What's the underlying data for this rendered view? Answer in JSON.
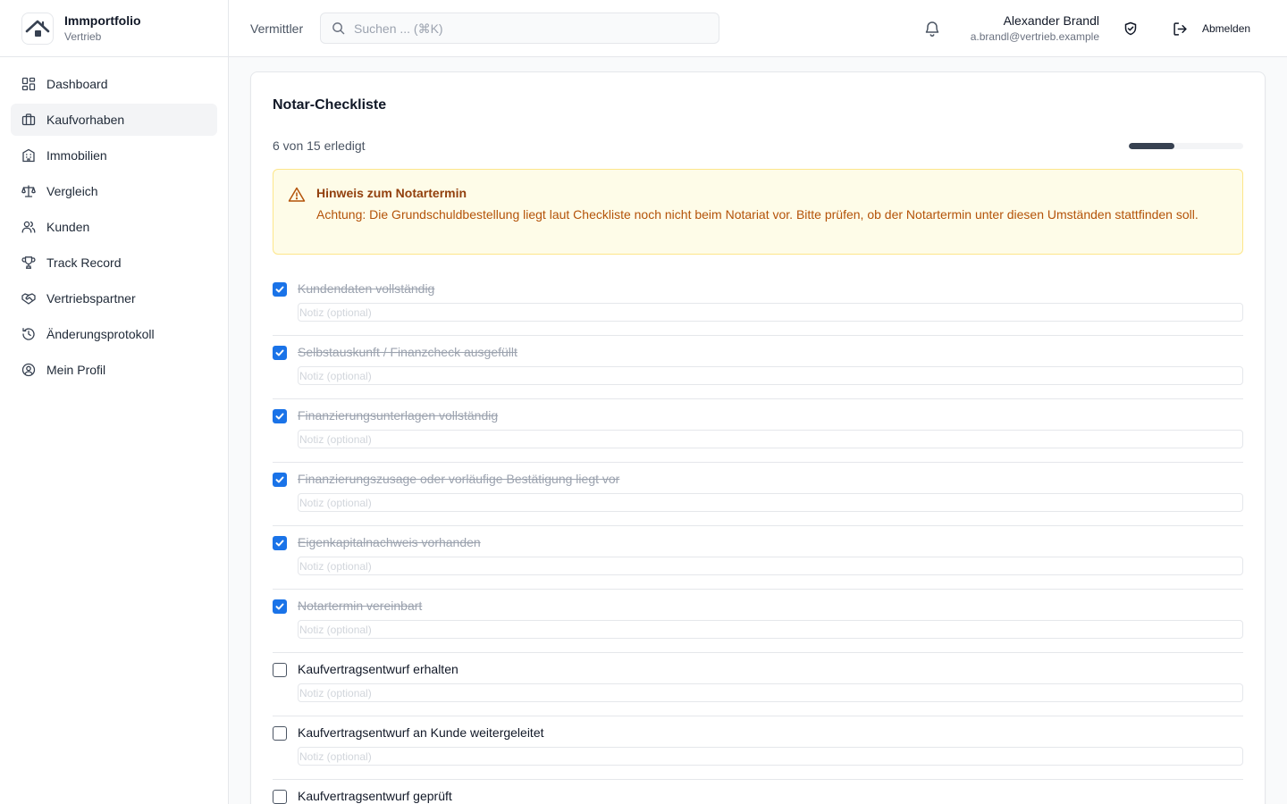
{
  "brand": {
    "name": "Immportfolio",
    "subtitle": "Vertrieb"
  },
  "sidebar": {
    "items": [
      {
        "label": "Dashboard",
        "icon": "dashboard-icon"
      },
      {
        "label": "Kaufvorhaben",
        "icon": "briefcase-icon",
        "active": true
      },
      {
        "label": "Immobilien",
        "icon": "building-icon"
      },
      {
        "label": "Vergleich",
        "icon": "scale-icon"
      },
      {
        "label": "Kunden",
        "icon": "users-icon"
      },
      {
        "label": "Track Record",
        "icon": "trophy-icon"
      },
      {
        "label": "Vertriebspartner",
        "icon": "handshake-icon"
      },
      {
        "label": "Änderungsprotokoll",
        "icon": "history-icon"
      },
      {
        "label": "Mein Profil",
        "icon": "user-circle-icon"
      }
    ]
  },
  "header": {
    "role": "Vermittler",
    "search_placeholder": "Suchen ... (⌘K)",
    "user_name": "Alexander Brandl",
    "user_email": "a.brandl@vertrieb.example",
    "logout_label": "Abmelden"
  },
  "checklist": {
    "title": "Notar-Checkliste",
    "progress_text": "6 von 15 erledigt",
    "done": 6,
    "total": 15,
    "alert": {
      "title": "Hinweis zum Notartermin",
      "text": "Achtung: Die Grundschuldbestellung liegt laut Checkliste noch nicht beim Notariat vor. Bitte prüfen, ob der Notartermin unter diesen Umständen stattfinden soll."
    },
    "note_placeholder": "Notiz (optional)",
    "items": [
      {
        "label": "Kundendaten vollständig",
        "done": true
      },
      {
        "label": "Selbstauskunft / Finanzcheck ausgefüllt",
        "done": true
      },
      {
        "label": "Finanzierungsunterlagen vollständig",
        "done": true
      },
      {
        "label": "Finanzierungszusage oder vorläufige Bestätigung liegt vor",
        "done": true
      },
      {
        "label": "Eigenkapitalnachweis vorhanden",
        "done": true
      },
      {
        "label": "Notartermin vereinbart",
        "done": true
      },
      {
        "label": "Kaufvertragsentwurf erhalten",
        "done": false
      },
      {
        "label": "Kaufvertragsentwurf an Kunde weitergeleitet",
        "done": false
      },
      {
        "label": "Kaufvertragsentwurf geprüft",
        "done": false
      }
    ]
  },
  "colors": {
    "accent": "#1a73e8",
    "warning_bg": "#fefce8",
    "warning_text": "#b45309",
    "progress": "#374151"
  }
}
